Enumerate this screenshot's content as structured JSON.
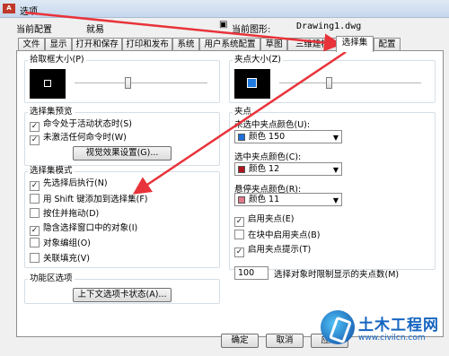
{
  "window": {
    "title": "选项",
    "app_icon": "A"
  },
  "profile": {
    "current_config_label": "当前配置",
    "current_config_value": "就易",
    "current_drawing_label": "当前图形:",
    "current_drawing_value": "Drawing1.dwg"
  },
  "tabs": [
    "文件",
    "显示",
    "打开和保存",
    "打印和发布",
    "系统",
    "用户系统配置",
    "草图",
    "三维建模",
    "选择集",
    "配置"
  ],
  "active_tab": "选择集",
  "pickbox": {
    "title": "拾取框大小(P)",
    "level": 0.4
  },
  "preview": {
    "title": "选择集预览",
    "active_command": "命令处于活动状态时(S)",
    "no_command": "未激活任何命令时(W)",
    "effects_button": "视觉效果设置(G)..."
  },
  "selection_modes": {
    "title": "选择集模式",
    "items": [
      {
        "label": "先选择后执行(N)",
        "checked": true
      },
      {
        "label": "用 Shift 键添加到选择集(F)",
        "checked": false
      },
      {
        "label": "按住并拖动(D)",
        "checked": false
      },
      {
        "label": "隐含选择窗口中的对象(I)",
        "checked": true
      },
      {
        "label": "对象编组(O)",
        "checked": false
      },
      {
        "label": "关联填充(V)",
        "checked": false
      }
    ]
  },
  "ribbon": {
    "title": "功能区选项",
    "button": "上下文选项卡状态(A)..."
  },
  "gripsize": {
    "title": "夹点大小(Z)",
    "level": 0.35
  },
  "grips": {
    "title": "夹点",
    "unselected_label": "未选中夹点颜色(U):",
    "unselected_value": "颜色 150",
    "unselected_color": "#1f6fdb",
    "selected_label": "选中夹点颜色(C):",
    "selected_value": "颜色 12",
    "selected_color": "#b0141e",
    "hover_label": "悬停夹点颜色(R):",
    "hover_value": "颜色 11",
    "hover_color": "#e07a8a",
    "options": [
      {
        "label": "启用夹点(E)",
        "checked": true
      },
      {
        "label": "在块中启用夹点(B)",
        "checked": false
      },
      {
        "label": "启用夹点提示(T)",
        "checked": true
      }
    ],
    "limit_value": "100",
    "limit_label": "选择对象时限制显示的夹点数(M)"
  },
  "buttons": {
    "ok": "确定",
    "cancel": "取消",
    "apply": "应用"
  },
  "watermark": {
    "name": "土木工程网",
    "url": "www.civilcn.com"
  },
  "annotation_color": "#e8333a"
}
